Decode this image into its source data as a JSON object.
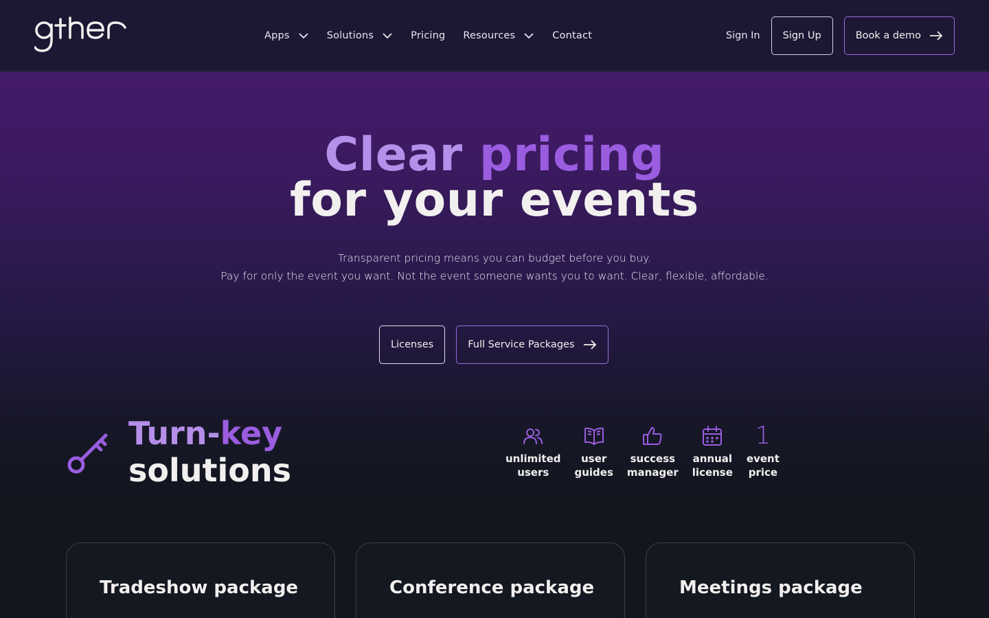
{
  "header": {
    "logo_text": "gther",
    "nav": [
      {
        "label": "Apps",
        "has_dropdown": true
      },
      {
        "label": "Solutions",
        "has_dropdown": true
      },
      {
        "label": "Pricing",
        "has_dropdown": false
      },
      {
        "label": "Resources",
        "has_dropdown": true
      },
      {
        "label": "Contact",
        "has_dropdown": false
      }
    ],
    "sign_in": "Sign In",
    "sign_up": "Sign Up",
    "book_demo": "Book a demo"
  },
  "hero": {
    "title_word1": "Clear",
    "title_word2": "pricing",
    "title_line2": "for your events",
    "sub_line1": "Transparent pricing means you can budget before you buy.",
    "sub_line2": "Pay for only the event you want. Not the event someone wants you to want. Clear, flexible, affordable.",
    "btn_licenses": "Licenses",
    "btn_full_service": "Full Service Packages"
  },
  "turnkey": {
    "title_a": "Turn-",
    "title_b": "key",
    "title_c": "solutions",
    "features": [
      {
        "icon": "users-icon",
        "label": "unlimited\nusers"
      },
      {
        "icon": "book-open-icon",
        "label": "user\nguides"
      },
      {
        "icon": "thumbs-up-icon",
        "label": "success\nmanager"
      },
      {
        "icon": "calendar-icon",
        "label": "annual\nlicense"
      },
      {
        "number": "1",
        "label": "event\nprice"
      }
    ]
  },
  "packages": [
    {
      "title": "Tradeshow package"
    },
    {
      "title": "Conference package"
    },
    {
      "title": "Meetings package"
    }
  ],
  "colors": {
    "accent_purple": "#9a5de0",
    "accent_light": "#b590ea",
    "header_bg": "#1c1733",
    "page_bg": "#12161f"
  }
}
